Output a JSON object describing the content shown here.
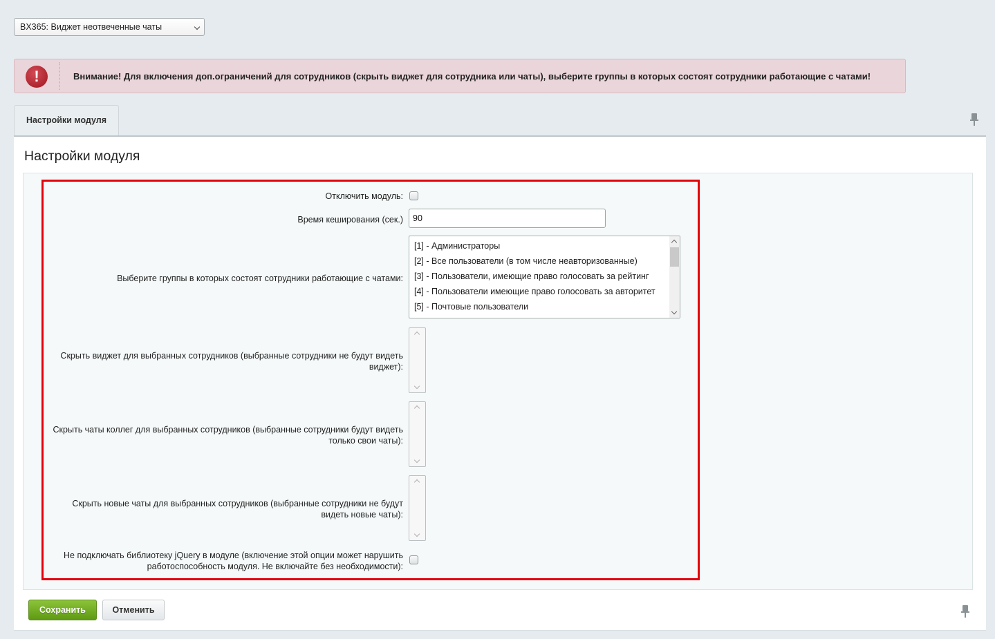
{
  "module_selector": {
    "selected": "BX365: Виджет неотвеченные чаты"
  },
  "alert": {
    "icon": "exclamation-icon",
    "text": "Внимание! Для включения доп.ограничений для сотрудников (скрыть виджет для сотрудника или чаты), выберите группы в которых состоят сотрудники работающие с чатами!"
  },
  "tabs": [
    {
      "label": "Настройки модуля"
    }
  ],
  "panel": {
    "title": "Настройки модуля",
    "fields": {
      "disable_module": {
        "label": "Отключить модуль:",
        "checked": false
      },
      "cache_time": {
        "label": "Время кеширования (сек.)",
        "value": "90"
      },
      "groups": {
        "label": "Выберите группы в которых состоят сотрудники работающие с чатами:",
        "options": [
          "[1] - Администраторы",
          "[2] - Все пользователи (в том числе неавторизованные)",
          "[3] - Пользователи, имеющие право голосовать за рейтинг",
          "[4] - Пользователи имеющие право голосовать за авторитет",
          "[5] - Почтовые пользователи"
        ]
      },
      "hide_widget": {
        "label_line1": "Скрыть виджет для выбранных сотрудников (выбранные сотрудники не будут видеть",
        "label_line2": "виджет):"
      },
      "hide_colleague_chats": {
        "label_line1": "Скрыть чаты коллег для выбранных сотрудников (выбранные сотрудники будут видеть",
        "label_line2": "только свои чаты):"
      },
      "hide_new_chats": {
        "label_line1": "Скрыть новые чаты для выбранных сотрудников (выбранные сотрудники не будут",
        "label_line2": "видеть новые чаты):"
      },
      "no_jquery": {
        "label_line1": "Не подключать библиотеку jQuery в модуле (включение этой опции может нарушить",
        "label_line2": "работоспособность модуля. Не включайте без необходимости):",
        "checked": false
      }
    }
  },
  "buttons": {
    "save": "Сохранить",
    "cancel": "Отменить"
  },
  "colors": {
    "highlight_frame": "#e3000b",
    "save_button": "#6fae1f",
    "alert_background": "#ead5da"
  }
}
